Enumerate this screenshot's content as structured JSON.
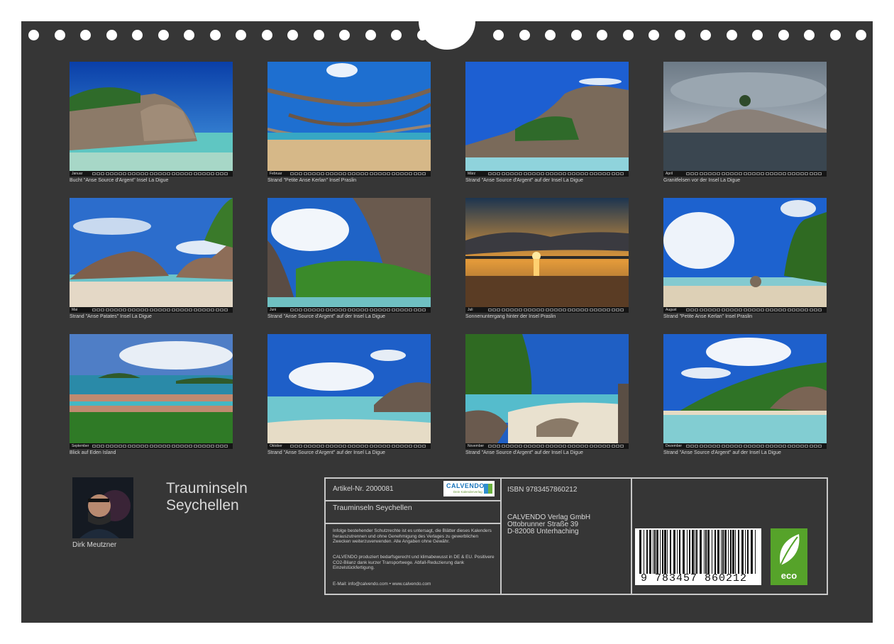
{
  "months": [
    {
      "label": "Januar",
      "caption": "Bucht \"Anse Source d'Argent\" Insel La Digue"
    },
    {
      "label": "Februar",
      "caption": "Strand \"Petite Anse Kerlan\" Insel Praslin"
    },
    {
      "label": "März",
      "caption": "Strand \"Anse Source d'Argent\" auf der Insel La Digue"
    },
    {
      "label": "April",
      "caption": "Granitfelsen vor der Insel La Digue"
    },
    {
      "label": "Mai",
      "caption": "Strand \"Anse Patates\" Insel La Digue"
    },
    {
      "label": "Juni",
      "caption": "Strand \"Anse Source d'Argent\" auf der Insel La Digue"
    },
    {
      "label": "Juli",
      "caption": "Sonnenuntergang hinter der Insel Praslin"
    },
    {
      "label": "August",
      "caption": "Strand \"Petite Anse Kerlan\" Insel Praslin"
    },
    {
      "label": "September",
      "caption": "Blick auf Eden Island"
    },
    {
      "label": "Oktober",
      "caption": "Strand \"Anse Source d'Argent\" auf der Insel La Digue"
    },
    {
      "label": "November",
      "caption": "Strand \"Anse Source d'Argent\" auf der Insel La Digue"
    },
    {
      "label": "Dezember",
      "caption": "Strand \"Anse Source d'Argent\" auf der Insel La Digue"
    }
  ],
  "author": {
    "name": "Dirk Meutzner"
  },
  "title": {
    "line1": "Trauminseln",
    "line2": "Seychellen"
  },
  "info": {
    "article": "Artikel-Nr. 2000081",
    "product_title": "Trauminseln Seychellen",
    "rights": "Infolge bestehender Schutzrechte ist es untersagt, die Blätter dieses Kalenders herauszutrennen und ohne Genehmigung des Verlages zu gewerblichen Zwecken weiterzuverwenden. Alle Angaben ohne Gewähr.",
    "climate": "CALVENDO produziert bedarfsgerecht und klimabewusst in DE & EU. Positivere CO2-Bilanz dank kurzer Transportwege. Abfall-Reduzierung dank Einzelstückfertigung.",
    "contact": "E-Mail: info@calvendo.com • www.calvendo.com",
    "isbn": "ISBN 9783457860212",
    "publisher1": "CALVENDO Verlag GmbH",
    "publisher2": "Ottobrunner Straße 39",
    "publisher3": "D-82008 Unterhaching",
    "barcode_number": "9 783457 860212",
    "logo_main": "CALVENDO",
    "logo_sub": "Dein Kalenderverlag",
    "eco": "eco"
  },
  "colors": {
    "board": "#363636",
    "text": "#d8d8d8",
    "eco": "#56a32a"
  }
}
